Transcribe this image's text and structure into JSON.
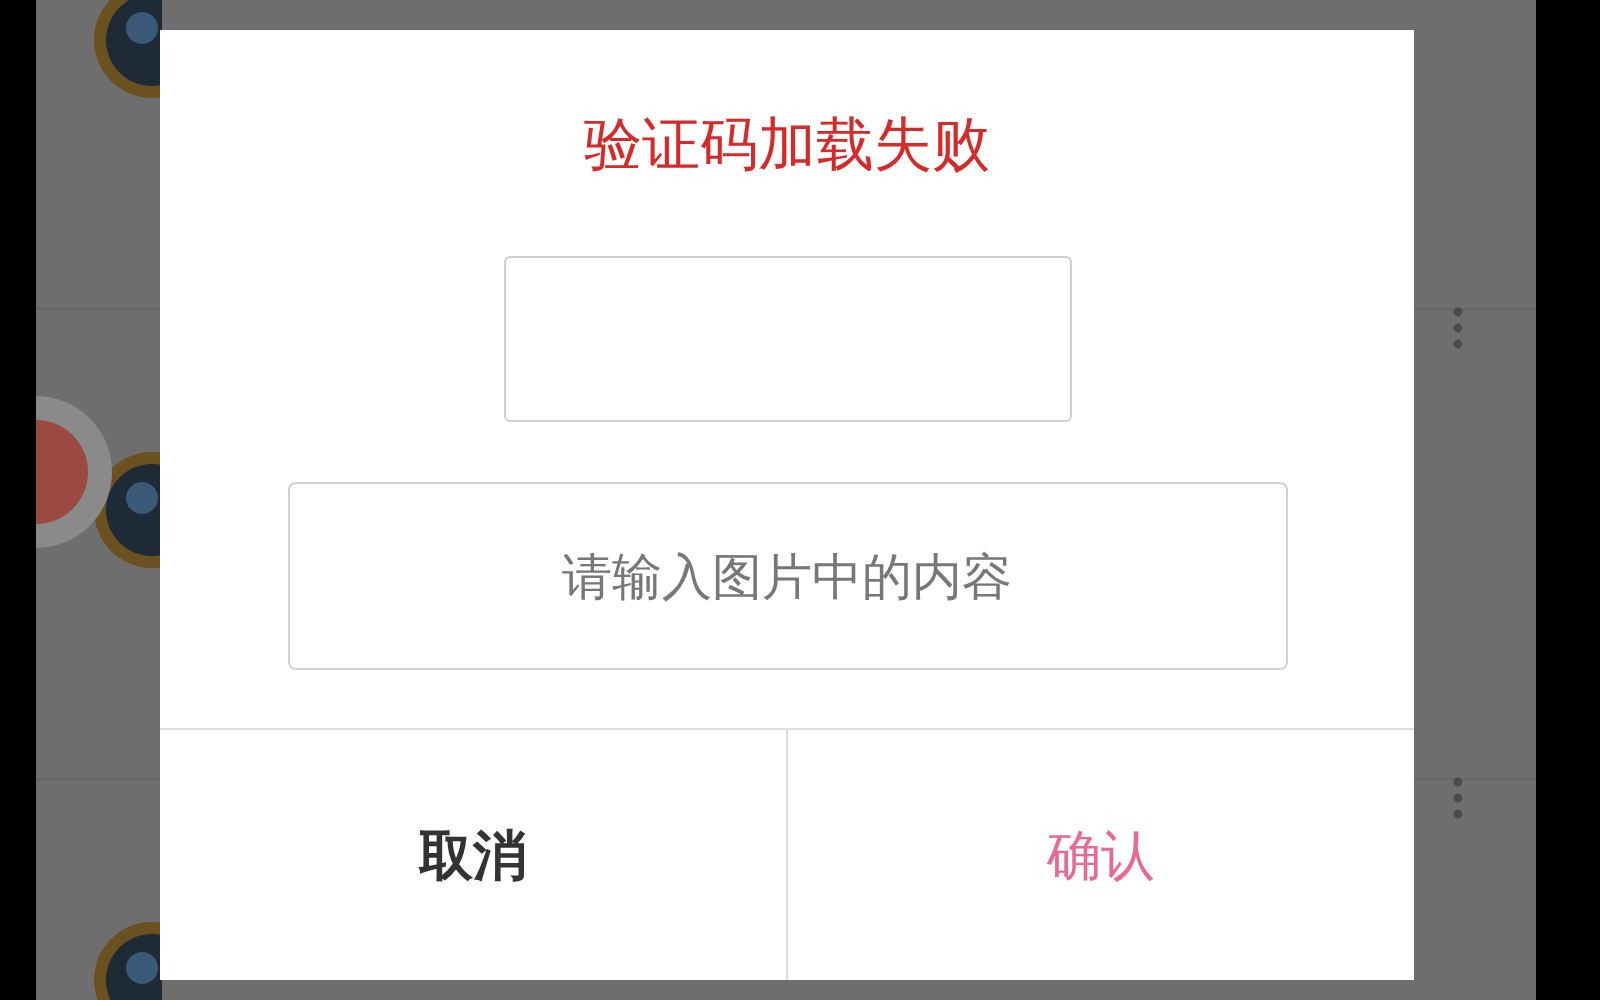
{
  "dialog": {
    "title": "验证码加载失败",
    "captcha_image": {
      "loaded": false
    },
    "input": {
      "placeholder": "请输入图片中的内容"
    },
    "buttons": [
      {
        "label": "取消",
        "kind": "cancel"
      },
      {
        "label": "确认",
        "kind": "confirm"
      }
    ]
  }
}
